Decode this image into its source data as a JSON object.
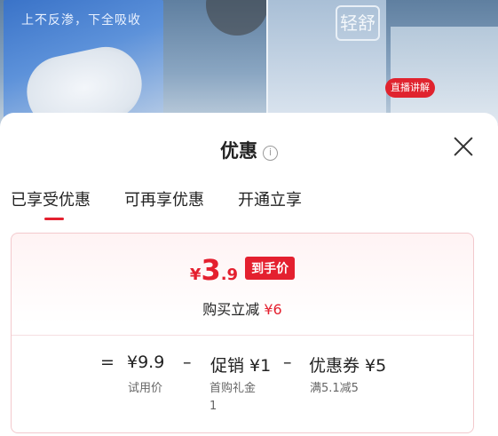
{
  "background": {
    "promo_line": "上不反渗，下全吸收",
    "box_mark": "轻舒",
    "live_badge": "直播讲解"
  },
  "sheet": {
    "title": "优惠",
    "info_icon": "i",
    "tabs": [
      {
        "label": "已享受优惠",
        "active": true
      },
      {
        "label": "可再享优惠",
        "active": false
      },
      {
        "label": "开通立享",
        "active": false
      }
    ],
    "card": {
      "currency": "¥",
      "price_int": "3",
      "price_dec": ".9",
      "price_tag": "到手价",
      "discount_label": "购买立减",
      "discount_amount": "¥6",
      "breakdown": {
        "eq": "=",
        "trial_price": "¥9.9",
        "minus1": "–",
        "promo": "促销 ¥1",
        "minus2": "–",
        "coupon": "优惠券 ¥5",
        "trial_label": "试用价",
        "promo_label_line1": "首购礼金",
        "promo_label_line2": "1",
        "coupon_label": "满5.1减5"
      }
    }
  },
  "colors": {
    "accent": "#e4202f",
    "card_border": "#f3c9cd"
  }
}
